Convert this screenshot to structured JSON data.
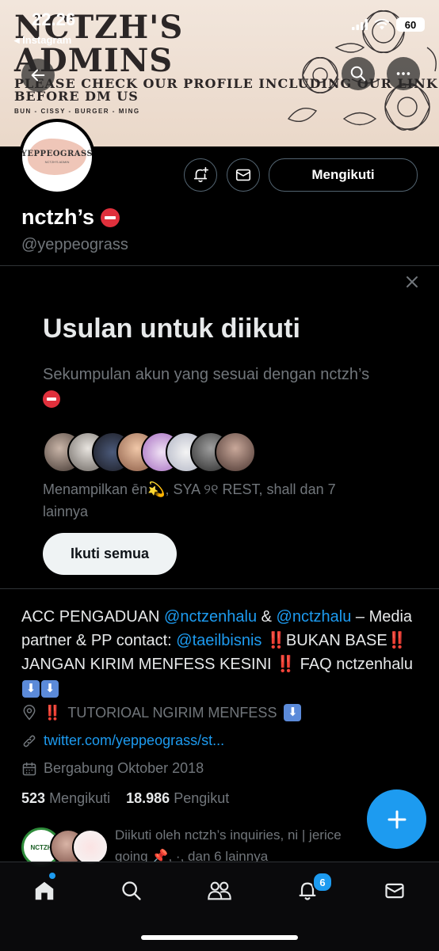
{
  "status": {
    "time": "22.26",
    "back_app": "◂ Instagram",
    "battery": "60"
  },
  "banner": {
    "line1": "NCTZH'S",
    "line2": "ADMINS",
    "line3": "PLEASE CHECK OUR PROFILE INCLUDING OUR LINK",
    "line4": "BEFORE DM US",
    "line5": "BUN - CISSY - BURGER - MING"
  },
  "avatar": {
    "text": "YEPPEOGRASS",
    "subtext": "NCTZH'S ADMIN"
  },
  "header": {
    "follow_button": "Mengikuti"
  },
  "profile": {
    "name": "nctzh’s",
    "handle": "@yeppeograss"
  },
  "suggestions": {
    "title": "Usulan untuk diikuti",
    "description": "Sekumpulan akun yang sesuai dengan nctzh’s",
    "shows": "Menampilkan ēn💫, SYA ୨୧ REST, shall dan 7 lainnya",
    "follow_all": "Ikuti semua"
  },
  "bio": {
    "p1": "ACC PENGADUAN ",
    "m1": "@nctzenhalu",
    "p2": " & ",
    "m2": "@nctzhalu",
    "p3": " – Media partner & PP contact: ",
    "m3": "@taeilbisnis",
    "ex": "‼️",
    "p4": "BUKAN BASE",
    "p5": " JANGAN KIRIM MENFESS KESINI ",
    "p6": " FAQ nctzenhalu ",
    "arrow": "⬇"
  },
  "meta": {
    "location": "TUTORIOAL NGIRIM MENFESS",
    "website": "twitter.com/yeppeograss/st...",
    "joined": "Bergabung Oktober 2018"
  },
  "counts": {
    "following_num": "523",
    "following_label": "Mengikuti",
    "followers_num": "18.986",
    "followers_label": "Pengikut"
  },
  "followed_by": {
    "text": "Diikuti oleh nctzh’s inquiries, ni | jerice going 📌, ·, dan 6 lainnya",
    "badge_text": "NCTZH"
  },
  "tabbar": {
    "notifications_badge": "6"
  },
  "colors": {
    "accent": "#1d9bf0",
    "muted": "#71767b",
    "banner_bg": "#f2e6dc"
  }
}
